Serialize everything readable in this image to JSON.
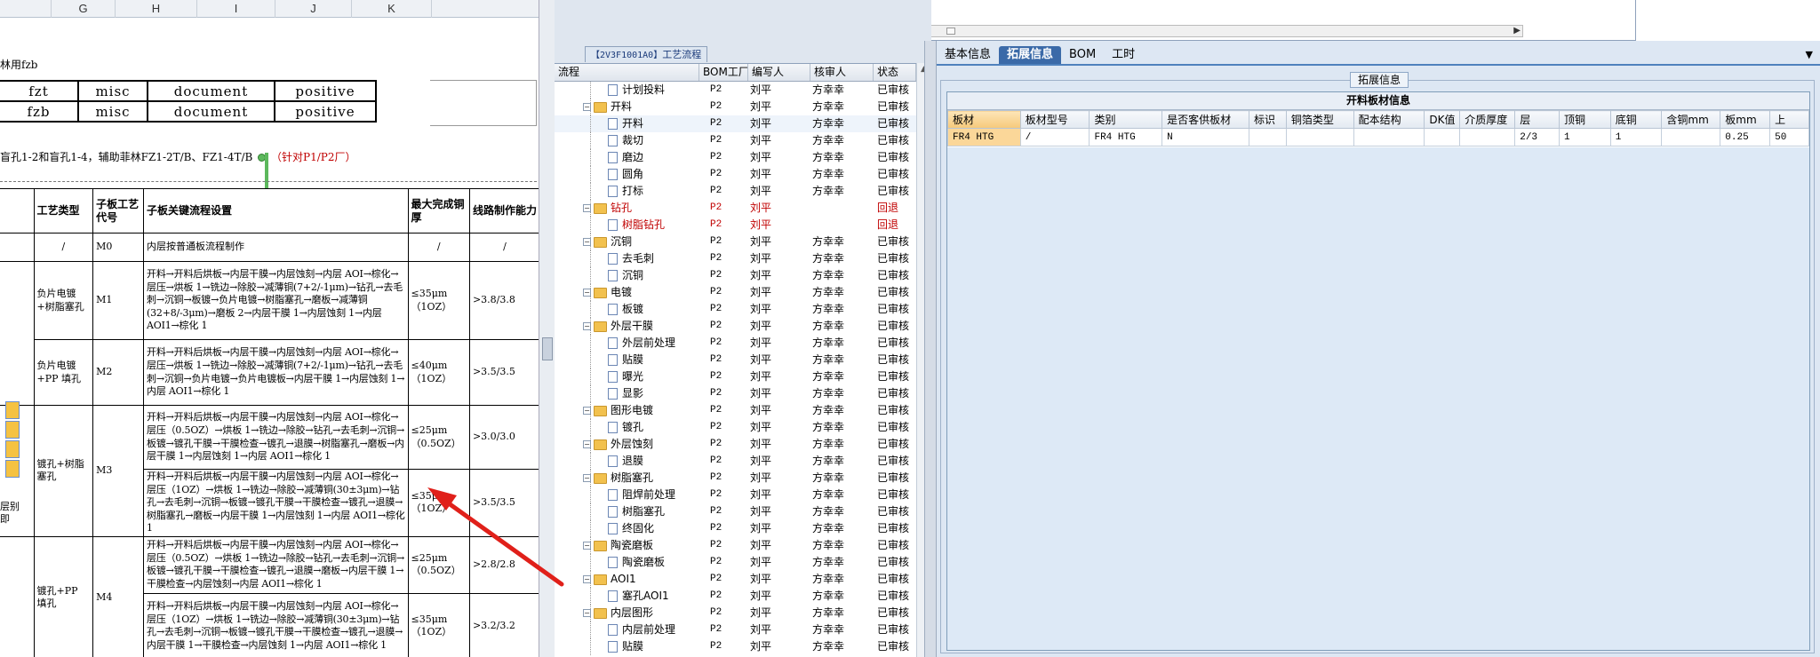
{
  "sheet": {
    "columns": [
      "G",
      "H",
      "I",
      "J",
      "K"
    ],
    "note_line": "林用fzb",
    "file_rows": [
      [
        "fzt",
        "misc",
        "document",
        "positive"
      ],
      [
        "fzb",
        "misc",
        "document",
        "positive"
      ]
    ],
    "instruction": "盲孔1-2和盲孔1-4，辅助菲林FZ1-2T/B、FZ1-4T/B",
    "instruction_red": "（针对P1/P2厂）",
    "side_text": "层别即",
    "headers": [
      "工艺类型",
      "子板工艺代号",
      "子板关键流程设置",
      "最大完成铜厚",
      "线路制作能力"
    ],
    "rows": [
      {
        "type": "/",
        "code": "M0",
        "flow": "内层按普通板流程制作",
        "cu": "/",
        "cap": "/"
      },
      {
        "type": "负片电镀+树脂塞孔",
        "code": "M1",
        "flow": "开料→开料后烘板→内层干膜→内层蚀刻→内层 AOI→棕化→层压→烘板 1→铣边→除胶→减薄铜(7+2/-1μm)→钻孔→去毛刺→沉铜→板镀→负片电镀→树脂塞孔→磨板→减薄铜(32+8/-3μm)→磨板 2→内层干膜 1→内层蚀刻 1→内层 AOI1→棕化 1",
        "cu": "≤35μm（1OZ）",
        "cap": ">3.8/3.8"
      },
      {
        "type": "负片电镀+PP 填孔",
        "code": "M2",
        "flow": "开料→开料后烘板→内层干膜→内层蚀刻→内层 AOI→棕化→层压→烘板 1→铣边→除胶→减薄铜(7+2/-1μm)→钻孔→去毛刺→沉铜→负片电镀→负片电镀板→内层干膜 1→内层蚀刻 1→内层 AOI1→棕化 1",
        "cu": "≤40μm（1OZ）",
        "cap": ">3.5/3.5"
      },
      {
        "type": "镀孔+树脂塞孔",
        "code": "M3",
        "flow": "开料→开料后烘板→内层干膜→内层蚀刻→内层 AOI→棕化→层压（0.5OZ）→烘板 1→铣边→除胶→钻孔→去毛刺→沉铜→板镀→镀孔干膜→干膜检查→镀孔→退膜→树脂塞孔→磨板→内层干膜 1→内层蚀刻 1→内层 AOI1→棕化 1",
        "cu": "≤25μm（0.5OZ）",
        "cap": ">3.0/3.0"
      },
      {
        "type": "",
        "code": "",
        "flow": "开料→开料后烘板→内层干膜→内层蚀刻→内层 AOI→棕化→层压（1OZ）→烘板 1→铣边→除胶→减薄铜(30±3μm)→钻孔→去毛刺→沉铜→板镀→镀孔干膜→干膜检查→镀孔→退膜→树脂塞孔→磨板→内层干膜 1→内层蚀刻 1→内层 AOI1→棕化 1",
        "cu": "≤35μm（1OZ）",
        "cap": ">3.5/3.5"
      },
      {
        "type": "镀孔+PP 填孔",
        "code": "M4",
        "flow": "开料→开料后烘板→内层干膜→内层蚀刻→内层 AOI→棕化→层压（0.5OZ）→烘板 1→铣边→除胶→钻孔→去毛刺→沉铜→板镀→镀孔干膜→干膜检查→镀孔→退膜→磨板→内层干膜 1→干膜检查→内层蚀刻→内层 AOI1→棕化 1",
        "cu": "≤25μm（0.5OZ）",
        "cap": ">2.8/2.8"
      },
      {
        "type": "",
        "code": "",
        "flow": "开料→开料后烘板→内层干膜→内层蚀刻→内层 AOI→棕化→层压（1OZ）→烘板 1→铣边→除胶→减薄铜(30±3μm)→钻孔→去毛刺→沉铜→板镀→镀孔干膜→干膜检查→镀孔→退膜→内层干膜 1→干膜检查→内层蚀刻 1→内层 AOI1→棕化 1",
        "cu": "≤35μm（1OZ）",
        "cap": ">3.2/3.2"
      }
    ]
  },
  "flow_panel": {
    "tab_code": "【2V3F1001A0】",
    "tab_label": "工艺流程",
    "columns": [
      "流程",
      "BOM工厂",
      "编写人",
      "核审人",
      "状态"
    ],
    "rows": [
      {
        "name": "计划投料",
        "level": 1,
        "kind": "doc",
        "factory": "P2",
        "writer": "刘平",
        "reviewer": "方幸幸",
        "status": "已审核",
        "red": false
      },
      {
        "name": "开料",
        "level": 0,
        "kind": "folder",
        "factory": "P2",
        "writer": "刘平",
        "reviewer": "方幸幸",
        "status": "已审核",
        "red": false
      },
      {
        "name": "开料",
        "level": 1,
        "kind": "doc",
        "factory": "P2",
        "writer": "刘平",
        "reviewer": "方幸幸",
        "status": "已审核",
        "red": false
      },
      {
        "name": "裁切",
        "level": 1,
        "kind": "doc",
        "factory": "P2",
        "writer": "刘平",
        "reviewer": "方幸幸",
        "status": "已审核",
        "red": false
      },
      {
        "name": "磨边",
        "level": 1,
        "kind": "doc",
        "factory": "P2",
        "writer": "刘平",
        "reviewer": "方幸幸",
        "status": "已审核",
        "red": false
      },
      {
        "name": "圆角",
        "level": 1,
        "kind": "doc",
        "factory": "P2",
        "writer": "刘平",
        "reviewer": "方幸幸",
        "status": "已审核",
        "red": false
      },
      {
        "name": "打标",
        "level": 1,
        "kind": "doc",
        "factory": "P2",
        "writer": "刘平",
        "reviewer": "方幸幸",
        "status": "已审核",
        "red": false
      },
      {
        "name": "钻孔",
        "level": 0,
        "kind": "folder",
        "factory": "P2",
        "writer": "刘平",
        "reviewer": "",
        "status": "回退",
        "red": true
      },
      {
        "name": "树脂钻孔",
        "level": 1,
        "kind": "doc",
        "factory": "P2",
        "writer": "刘平",
        "reviewer": "",
        "status": "回退",
        "red": true
      },
      {
        "name": "沉铜",
        "level": 0,
        "kind": "folder",
        "factory": "P2",
        "writer": "刘平",
        "reviewer": "方幸幸",
        "status": "已审核",
        "red": false
      },
      {
        "name": "去毛刺",
        "level": 1,
        "kind": "doc",
        "factory": "P2",
        "writer": "刘平",
        "reviewer": "方幸幸",
        "status": "已审核",
        "red": false
      },
      {
        "name": "沉铜",
        "level": 1,
        "kind": "doc",
        "factory": "P2",
        "writer": "刘平",
        "reviewer": "方幸幸",
        "status": "已审核",
        "red": false
      },
      {
        "name": "电镀",
        "level": 0,
        "kind": "folder",
        "factory": "P2",
        "writer": "刘平",
        "reviewer": "方幸幸",
        "status": "已审核",
        "red": false
      },
      {
        "name": "板镀",
        "level": 1,
        "kind": "doc",
        "factory": "P2",
        "writer": "刘平",
        "reviewer": "方幸幸",
        "status": "已审核",
        "red": false
      },
      {
        "name": "外层干膜",
        "level": 0,
        "kind": "folder",
        "factory": "P2",
        "writer": "刘平",
        "reviewer": "方幸幸",
        "status": "已审核",
        "red": false
      },
      {
        "name": "外层前处理",
        "level": 1,
        "kind": "doc",
        "factory": "P2",
        "writer": "刘平",
        "reviewer": "方幸幸",
        "status": "已审核",
        "red": false
      },
      {
        "name": "贴膜",
        "level": 1,
        "kind": "doc",
        "factory": "P2",
        "writer": "刘平",
        "reviewer": "方幸幸",
        "status": "已审核",
        "red": false
      },
      {
        "name": "曝光",
        "level": 1,
        "kind": "doc",
        "factory": "P2",
        "writer": "刘平",
        "reviewer": "方幸幸",
        "status": "已审核",
        "red": false
      },
      {
        "name": "显影",
        "level": 1,
        "kind": "doc",
        "factory": "P2",
        "writer": "刘平",
        "reviewer": "方幸幸",
        "status": "已审核",
        "red": false
      },
      {
        "name": "图形电镀",
        "level": 0,
        "kind": "folder",
        "factory": "P2",
        "writer": "刘平",
        "reviewer": "方幸幸",
        "status": "已审核",
        "red": false
      },
      {
        "name": "镀孔",
        "level": 1,
        "kind": "doc",
        "factory": "P2",
        "writer": "刘平",
        "reviewer": "方幸幸",
        "status": "已审核",
        "red": false
      },
      {
        "name": "外层蚀刻",
        "level": 0,
        "kind": "folder",
        "factory": "P2",
        "writer": "刘平",
        "reviewer": "方幸幸",
        "status": "已审核",
        "red": false
      },
      {
        "name": "退膜",
        "level": 1,
        "kind": "doc",
        "factory": "P2",
        "writer": "刘平",
        "reviewer": "方幸幸",
        "status": "已审核",
        "red": false
      },
      {
        "name": "树脂塞孔",
        "level": 0,
        "kind": "folder",
        "factory": "P2",
        "writer": "刘平",
        "reviewer": "方幸幸",
        "status": "已审核",
        "red": false
      },
      {
        "name": "阻焊前处理",
        "level": 1,
        "kind": "doc",
        "factory": "P2",
        "writer": "刘平",
        "reviewer": "方幸幸",
        "status": "已审核",
        "red": false
      },
      {
        "name": "树脂塞孔",
        "level": 1,
        "kind": "doc",
        "factory": "P2",
        "writer": "刘平",
        "reviewer": "方幸幸",
        "status": "已审核",
        "red": false
      },
      {
        "name": "终固化",
        "level": 1,
        "kind": "doc",
        "factory": "P2",
        "writer": "刘平",
        "reviewer": "方幸幸",
        "status": "已审核",
        "red": false
      },
      {
        "name": "陶瓷磨板",
        "level": 0,
        "kind": "folder",
        "factory": "P2",
        "writer": "刘平",
        "reviewer": "方幸幸",
        "status": "已审核",
        "red": false
      },
      {
        "name": "陶瓷磨板",
        "level": 1,
        "kind": "doc",
        "factory": "P2",
        "writer": "刘平",
        "reviewer": "方幸幸",
        "status": "已审核",
        "red": false
      },
      {
        "name": "AOI1",
        "level": 0,
        "kind": "folder",
        "factory": "P2",
        "writer": "刘平",
        "reviewer": "方幸幸",
        "status": "已审核",
        "red": false
      },
      {
        "name": "塞孔AOI1",
        "level": 1,
        "kind": "doc",
        "factory": "P2",
        "writer": "刘平",
        "reviewer": "方幸幸",
        "status": "已审核",
        "red": false
      },
      {
        "name": "内层图形",
        "level": 0,
        "kind": "folder",
        "factory": "P2",
        "writer": "刘平",
        "reviewer": "方幸幸",
        "status": "已审核",
        "red": false
      },
      {
        "name": "内层前处理",
        "level": 1,
        "kind": "doc",
        "factory": "P2",
        "writer": "刘平",
        "reviewer": "方幸幸",
        "status": "已审核",
        "red": false
      },
      {
        "name": "贴膜",
        "level": 1,
        "kind": "doc",
        "factory": "P2",
        "writer": "刘平",
        "reviewer": "方幸幸",
        "status": "已审核",
        "red": false
      }
    ]
  },
  "detail": {
    "tabs": [
      "基本信息",
      "拓展信息",
      "BOM",
      "工时"
    ],
    "active_tab": 1,
    "group_title": "拓展信息",
    "grid_title": "开料板材信息",
    "columns": [
      "板材",
      "板材型号",
      "类别",
      "是否客供板材",
      "标识",
      "铜箔类型",
      "配本结构",
      "DK值",
      "介质厚度",
      "层",
      "顶铜",
      "底铜",
      "含铜mm",
      "板mm",
      "上"
    ],
    "row": [
      "FR4 HTG",
      "/",
      "FR4 HTG",
      "N",
      "",
      "",
      "",
      "",
      "",
      "2/3",
      "1",
      "1",
      "",
      "0.25",
      "50"
    ]
  },
  "colors": {
    "accent": "#3b6aa8",
    "red": "#c00000",
    "arrow": "#e0201a"
  }
}
